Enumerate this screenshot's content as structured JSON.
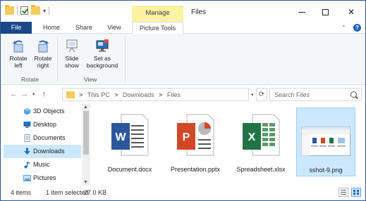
{
  "window": {
    "title": "Files",
    "context_tab": "Manage",
    "controls": {
      "minimize": "",
      "maximize": "",
      "close": "✕"
    }
  },
  "ribbon": {
    "tabs": [
      {
        "label": "File"
      },
      {
        "label": "Home"
      },
      {
        "label": "Share"
      },
      {
        "label": "View"
      },
      {
        "label": "Picture Tools"
      }
    ],
    "groups": {
      "rotate": {
        "label": "Rotate",
        "buttons": [
          {
            "label_line1": "Rotate",
            "label_line2": "left",
            "icon": "rotate-left-icon"
          },
          {
            "label_line1": "Rotate",
            "label_line2": "right",
            "icon": "rotate-right-icon"
          }
        ]
      },
      "view": {
        "label": "View",
        "buttons": [
          {
            "label_line1": "Slide",
            "label_line2": "show",
            "icon": "slideshow-icon"
          },
          {
            "label_line1": "Set as",
            "label_line2": "background",
            "icon": "set-background-icon"
          }
        ]
      }
    },
    "help": "?"
  },
  "address": {
    "path": [
      "This PC",
      "Downloads",
      "Files"
    ],
    "separator": ">"
  },
  "search": {
    "placeholder": "Search Files"
  },
  "nav_pane": {
    "items": [
      {
        "label": "3D Objects",
        "icon": "3d-objects-icon",
        "color": "#4ba3e3"
      },
      {
        "label": "Desktop",
        "icon": "desktop-icon",
        "color": "#1e73be"
      },
      {
        "label": "Documents",
        "icon": "documents-icon",
        "color": "#8a9bb0"
      },
      {
        "label": "Downloads",
        "icon": "downloads-icon",
        "color": "#1e73be",
        "selected": true
      },
      {
        "label": "Music",
        "icon": "music-icon",
        "color": "#1e73be"
      },
      {
        "label": "Pictures",
        "icon": "pictures-icon",
        "color": "#5ea0d8"
      }
    ]
  },
  "files": [
    {
      "name": "Document.docx",
      "icon": "word-doc-icon",
      "color": "#2b579a",
      "letter": "W"
    },
    {
      "name": "Presentation.pptx",
      "icon": "powerpoint-doc-icon",
      "color": "#d24726",
      "letter": "P"
    },
    {
      "name": "Spreadsheet.xlsx",
      "icon": "excel-doc-icon",
      "color": "#217346",
      "letter": "X"
    },
    {
      "name": "sshot-9.png",
      "icon": "image-thumbnail-icon",
      "selected": true
    }
  ],
  "status": {
    "item_count": "4 items",
    "selection": "1 item selected",
    "size": "27.0 KB"
  },
  "colors": {
    "file_tab": "#19478a",
    "manage_tab": "#fbf3a3",
    "selection": "#cce8ff"
  }
}
